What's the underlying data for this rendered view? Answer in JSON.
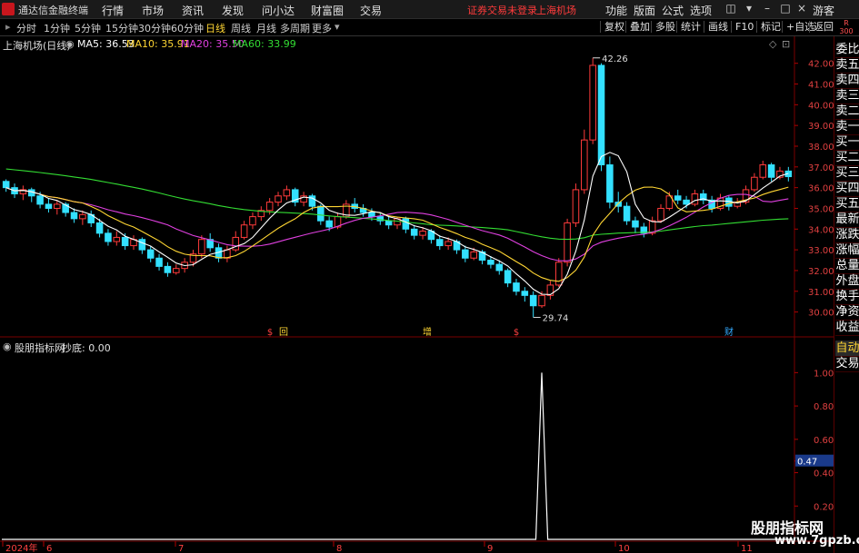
{
  "app": {
    "title": "通达信金融终端"
  },
  "menu": [
    "行情",
    "市场",
    "资讯",
    "发现",
    "问小达",
    "财富圈",
    "交易"
  ],
  "notice": {
    "text": "证券交易未登录",
    "stock": "上海机场"
  },
  "right_menu": [
    "功能",
    "版面",
    "公式",
    "选项"
  ],
  "guest": "游客",
  "periods": [
    "分时",
    "1分钟",
    "5分钟",
    "15分钟",
    "30分钟",
    "60分钟",
    "日线",
    "周线",
    "月线",
    "多周期",
    "更多"
  ],
  "active_period": "日线",
  "toolbar": [
    "复权",
    "叠加",
    "多股",
    "统计",
    "画线",
    "F10",
    "标记",
    "+自选",
    "返回"
  ],
  "r_badge": {
    "top": "R",
    "bottom": "300"
  },
  "sidebar": [
    "委比",
    "卖五",
    "卖四",
    "卖三",
    "卖二",
    "卖一",
    "买一",
    "买二",
    "买三",
    "买四",
    "买五",
    "最新",
    "涨跌",
    "涨幅",
    "总量",
    "外盘",
    "换手",
    "净资",
    "收益",
    "自动",
    "交易"
  ],
  "sidebar_active": "自动",
  "main_legend": {
    "name": "上海机场(日线)",
    "ma": [
      {
        "label": "MA5: 36.53",
        "color": "#ffffff"
      },
      {
        "label": "MA10: 35.91",
        "color": "#ffd633"
      },
      {
        "label": "MA20: 35.50",
        "color": "#e040e0"
      },
      {
        "label": "MA60: 33.99",
        "color": "#33dd33"
      }
    ]
  },
  "sub_legend": {
    "name": "股朋指标网",
    "value": "抄底: 0.00"
  },
  "chart_data": {
    "type": "candlestick",
    "up_color": "#ff3b3b",
    "down_color": "#33e0ff",
    "ma_colors": {
      "ma5": "#ffffff",
      "ma10": "#ffd633",
      "ma20": "#e040e0",
      "ma60": "#33dd33"
    },
    "ylim": [
      29.5,
      42.6
    ],
    "y_ticks": [
      "42.00",
      "41.00",
      "40.00",
      "39.00",
      "38.00",
      "37.00",
      "36.00",
      "35.00",
      "34.00",
      "33.00",
      "32.00",
      "31.00",
      "30.00"
    ],
    "annotations": [
      {
        "label": "42.26",
        "value": 42.26
      },
      {
        "label": "29.74",
        "value": 29.74
      }
    ],
    "events": [
      "$",
      "回",
      "增",
      "$",
      "财"
    ],
    "candles": [
      [
        36.3,
        36.0,
        36.4,
        35.8
      ],
      [
        36.0,
        35.7,
        36.2,
        35.5
      ],
      [
        35.7,
        35.9,
        36.1,
        35.4
      ],
      [
        35.9,
        35.6,
        36.0,
        35.3
      ],
      [
        35.6,
        35.2,
        35.8,
        35.0
      ],
      [
        35.2,
        35.0,
        35.5,
        34.8
      ],
      [
        35.0,
        35.2,
        35.4,
        34.7
      ],
      [
        35.2,
        34.8,
        35.3,
        34.6
      ],
      [
        34.8,
        34.5,
        35.0,
        34.3
      ],
      [
        34.5,
        34.7,
        34.9,
        34.2
      ],
      [
        34.7,
        34.3,
        34.9,
        34.1
      ],
      [
        34.3,
        33.8,
        34.5,
        33.6
      ],
      [
        33.8,
        33.4,
        34.0,
        33.2
      ],
      [
        33.4,
        33.6,
        33.9,
        33.2
      ],
      [
        33.6,
        33.2,
        33.8,
        33.0
      ],
      [
        33.2,
        33.5,
        33.7,
        33.0
      ],
      [
        33.5,
        33.0,
        33.6,
        32.8
      ],
      [
        33.0,
        32.6,
        33.2,
        32.4
      ],
      [
        32.6,
        32.2,
        32.8,
        32.0
      ],
      [
        32.2,
        31.9,
        32.4,
        31.7
      ],
      [
        31.9,
        32.1,
        32.3,
        31.8
      ],
      [
        32.1,
        32.4,
        32.6,
        31.9
      ],
      [
        32.4,
        32.8,
        33.0,
        32.2
      ],
      [
        32.8,
        33.5,
        33.7,
        32.6
      ],
      [
        33.5,
        33.1,
        33.8,
        32.9
      ],
      [
        33.1,
        32.6,
        33.3,
        32.4
      ],
      [
        32.6,
        33.0,
        33.2,
        32.4
      ],
      [
        33.0,
        33.6,
        33.9,
        32.9
      ],
      [
        33.6,
        34.2,
        34.4,
        33.5
      ],
      [
        34.2,
        34.6,
        34.8,
        34.0
      ],
      [
        34.6,
        34.9,
        35.1,
        34.4
      ],
      [
        34.9,
        35.3,
        35.5,
        34.7
      ],
      [
        35.3,
        35.6,
        35.8,
        35.1
      ],
      [
        35.6,
        35.9,
        36.1,
        35.4
      ],
      [
        35.9,
        35.3,
        36.0,
        35.1
      ],
      [
        35.3,
        35.6,
        35.8,
        35.1
      ],
      [
        35.6,
        35.1,
        35.7,
        34.9
      ],
      [
        35.1,
        34.4,
        35.2,
        34.2
      ],
      [
        34.4,
        34.1,
        34.6,
        33.9
      ],
      [
        34.1,
        34.6,
        34.8,
        34.0
      ],
      [
        34.6,
        35.2,
        35.4,
        34.5
      ],
      [
        35.2,
        35.0,
        35.5,
        34.8
      ],
      [
        35.0,
        34.8,
        35.2,
        34.6
      ],
      [
        34.8,
        34.6,
        35.0,
        34.4
      ],
      [
        34.6,
        34.4,
        34.8,
        34.2
      ],
      [
        34.4,
        34.2,
        34.6,
        34.0
      ],
      [
        34.2,
        34.5,
        34.6,
        34.0
      ],
      [
        34.5,
        34.0,
        34.6,
        33.8
      ],
      [
        34.0,
        33.7,
        34.2,
        33.5
      ],
      [
        33.7,
        33.9,
        34.1,
        33.5
      ],
      [
        33.9,
        33.5,
        34.0,
        33.3
      ],
      [
        33.5,
        33.2,
        33.7,
        33.0
      ],
      [
        33.2,
        33.4,
        33.6,
        33.0
      ],
      [
        33.4,
        33.0,
        33.5,
        32.8
      ],
      [
        33.0,
        32.6,
        33.2,
        32.4
      ],
      [
        32.6,
        32.9,
        33.1,
        32.5
      ],
      [
        32.9,
        32.5,
        33.0,
        32.3
      ],
      [
        32.5,
        32.3,
        32.7,
        32.1
      ],
      [
        32.3,
        32.0,
        32.5,
        31.8
      ],
      [
        32.0,
        31.4,
        32.1,
        31.2
      ],
      [
        31.4,
        31.0,
        31.6,
        30.8
      ],
      [
        31.0,
        30.8,
        31.2,
        30.5
      ],
      [
        30.8,
        30.3,
        31.0,
        29.74
      ],
      [
        30.3,
        30.8,
        31.0,
        30.2
      ],
      [
        30.8,
        31.3,
        31.5,
        30.6
      ],
      [
        31.3,
        32.4,
        32.6,
        31.2
      ],
      [
        32.4,
        34.3,
        34.5,
        32.2
      ],
      [
        34.3,
        35.9,
        36.2,
        34.1
      ],
      [
        35.9,
        38.3,
        38.8,
        35.7
      ],
      [
        38.3,
        41.9,
        42.26,
        38.1
      ],
      [
        41.9,
        37.1,
        42.0,
        36.8
      ],
      [
        37.1,
        35.3,
        37.5,
        35.0
      ],
      [
        35.3,
        35.1,
        35.8,
        34.8
      ],
      [
        35.1,
        34.4,
        35.3,
        34.2
      ],
      [
        34.4,
        34.1,
        34.6,
        33.8
      ],
      [
        34.1,
        33.8,
        34.3,
        33.6
      ],
      [
        33.8,
        34.4,
        34.6,
        33.7
      ],
      [
        34.4,
        35.0,
        35.2,
        34.3
      ],
      [
        35.0,
        35.6,
        35.8,
        34.9
      ],
      [
        35.6,
        35.4,
        35.9,
        35.2
      ],
      [
        35.4,
        35.2,
        35.6,
        35.0
      ],
      [
        35.2,
        35.7,
        35.9,
        35.1
      ],
      [
        35.7,
        35.4,
        35.9,
        35.2
      ],
      [
        35.4,
        35.0,
        35.6,
        34.8
      ],
      [
        35.0,
        35.5,
        35.7,
        34.9
      ],
      [
        35.5,
        35.1,
        35.6,
        34.9
      ],
      [
        35.1,
        35.3,
        35.5,
        35.0
      ],
      [
        35.3,
        35.9,
        36.1,
        35.2
      ],
      [
        35.9,
        36.5,
        36.7,
        35.8
      ],
      [
        36.5,
        37.1,
        37.3,
        36.4
      ],
      [
        37.1,
        36.5,
        37.2,
        36.3
      ],
      [
        36.5,
        36.8,
        37.0,
        36.4
      ],
      [
        36.8,
        36.53,
        37.0,
        36.3
      ]
    ],
    "sub": {
      "ylim": [
        0,
        1.1
      ],
      "y_ticks": [
        "1.00",
        "0.80",
        "0.60",
        "0.47",
        "0.40",
        "0.20"
      ],
      "highlight_tick": "0.47",
      "spike_index": 63,
      "spike_value": 1.0
    },
    "x_ticks": [
      "2024年",
      "6",
      "7",
      "8",
      "9",
      "10",
      "11"
    ]
  },
  "watermark": {
    "line1": "股朋指标网",
    "line2": "www.7gpzb.com"
  }
}
